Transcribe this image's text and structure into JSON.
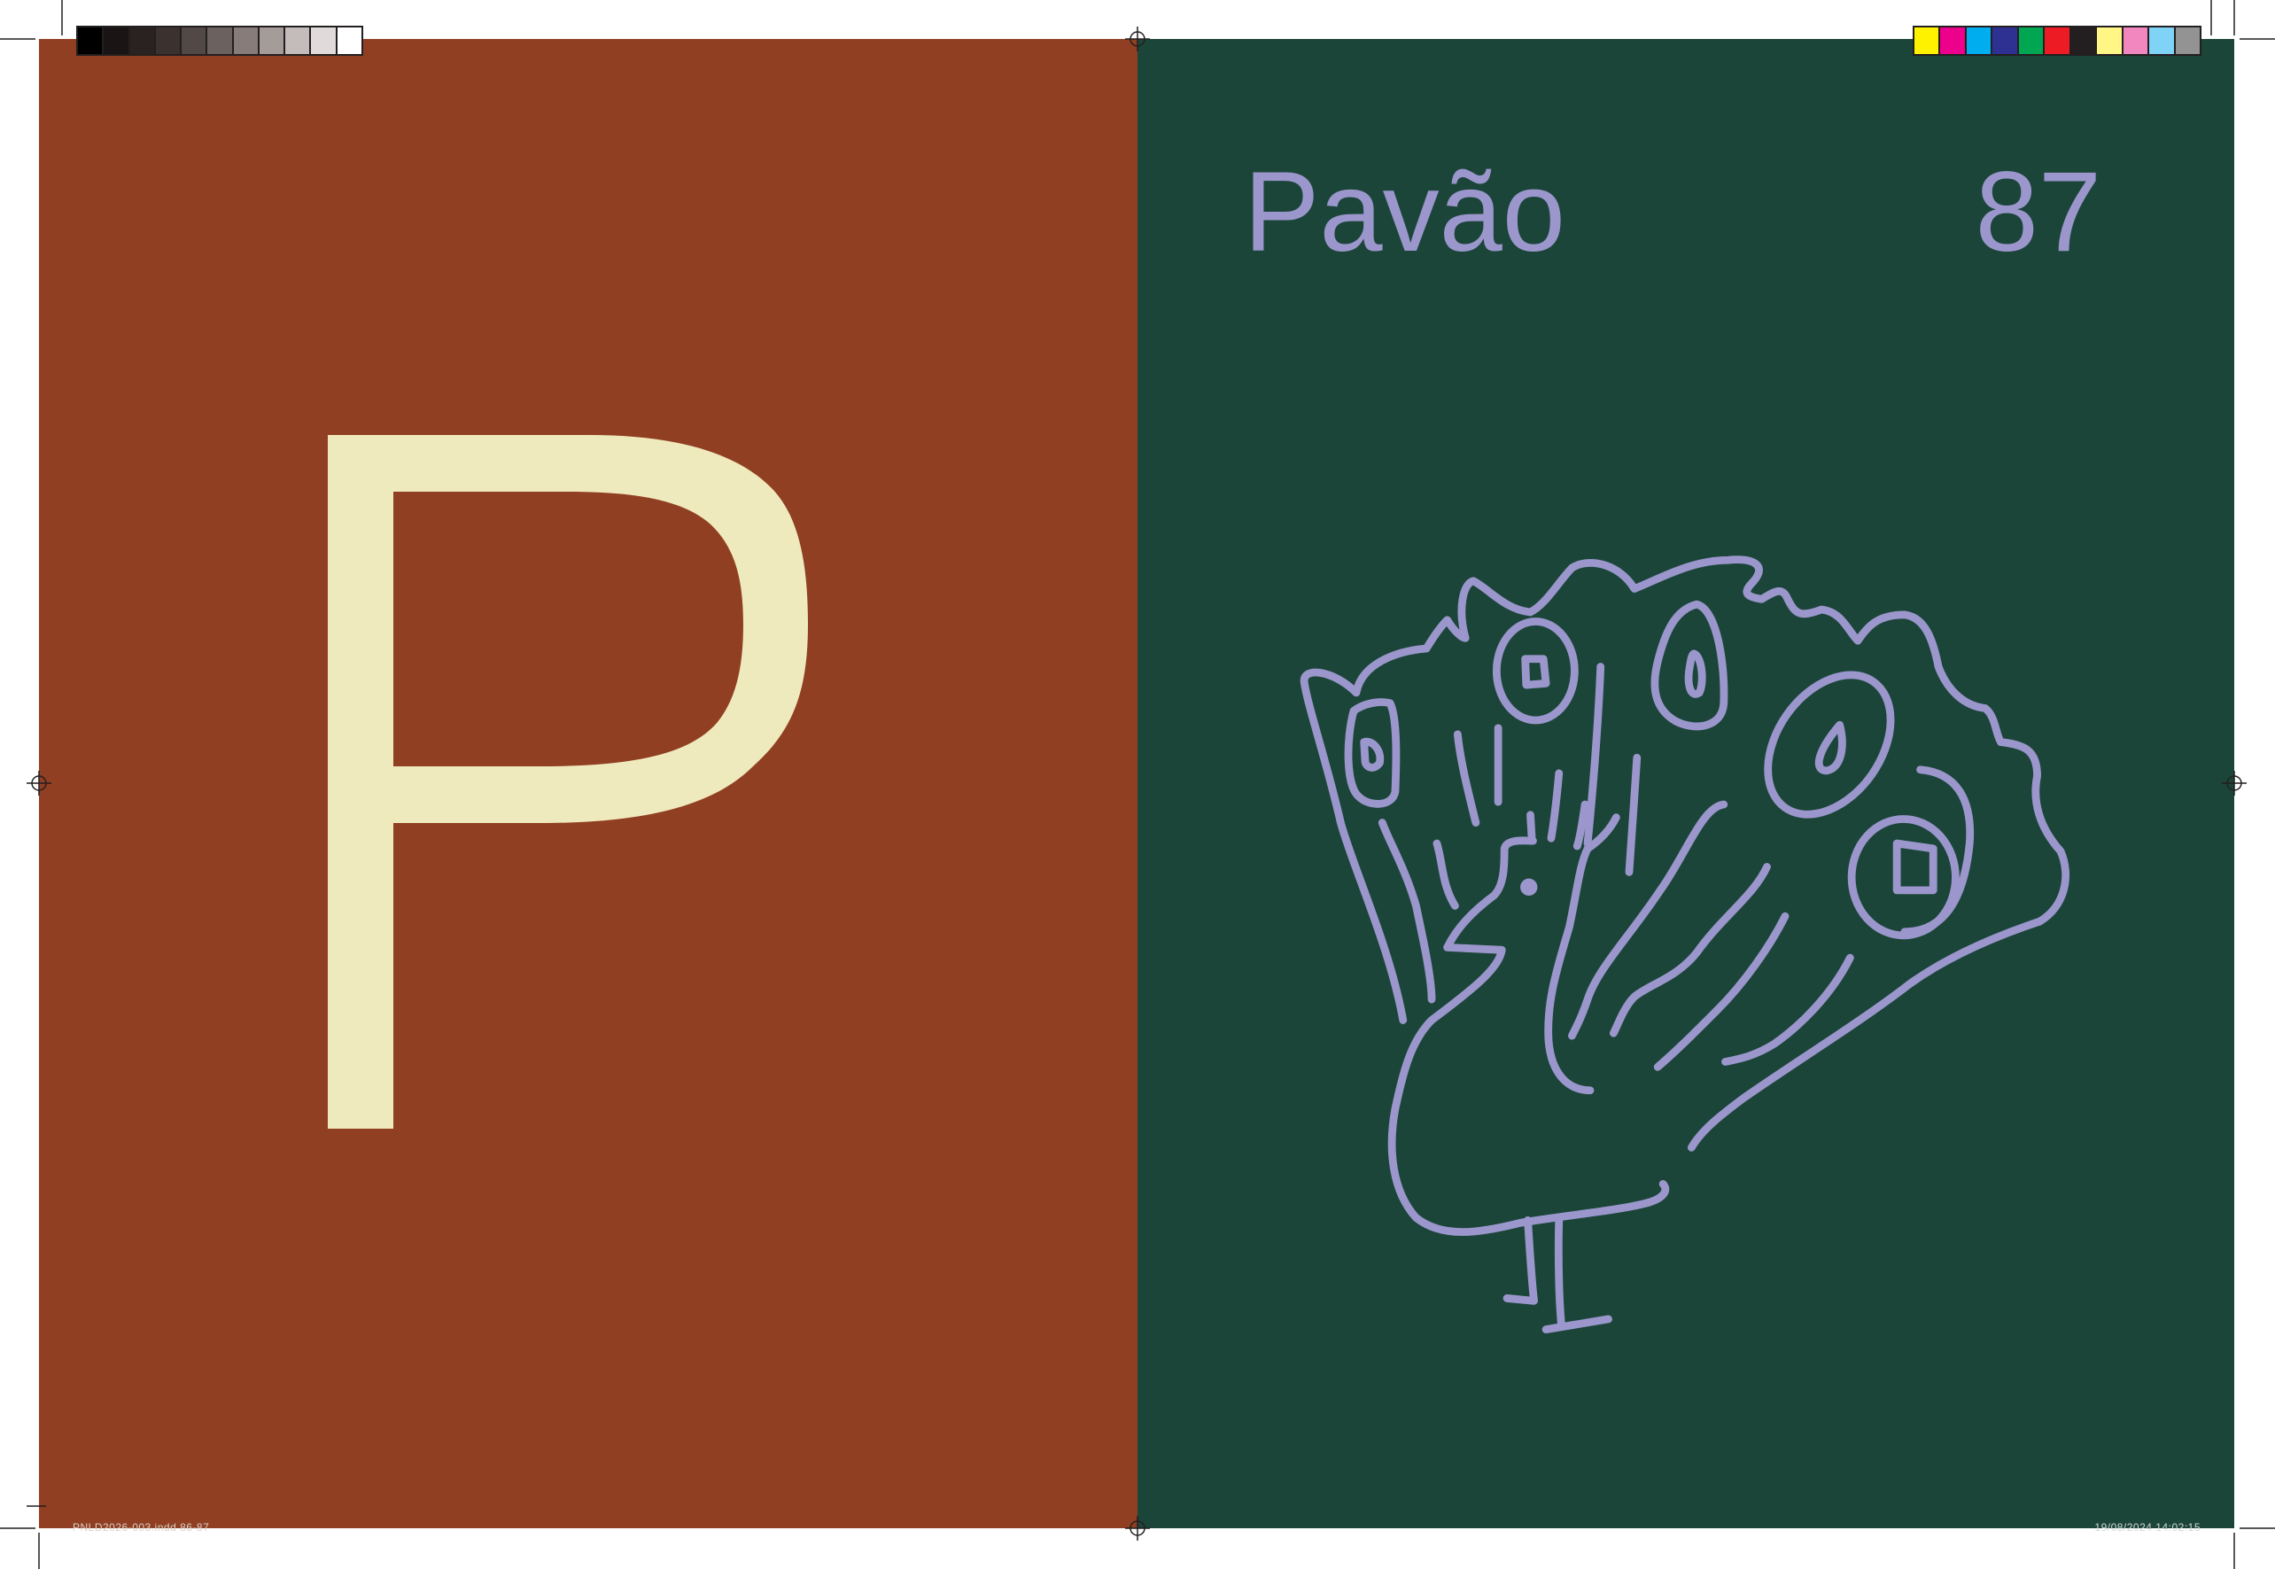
{
  "spread": {
    "left": {
      "letter": "P",
      "background": "#913f22",
      "letter_color": "#efeabd"
    },
    "right": {
      "word": "Pavão",
      "page_number": "87",
      "background": "#1c453a",
      "text_color": "#9b97cc",
      "illustration": "peacock-drawing"
    }
  },
  "print_marks": {
    "slug_file": "PNLD2026-003.indd   86-87",
    "slug_date": "19/08/2024   14:02:15",
    "gray_swatches": [
      "#000000",
      "#1a1414",
      "#2a2220",
      "#3b3230",
      "#524846",
      "#6b615f",
      "#877c7a",
      "#a59b99",
      "#c4bcba",
      "#e0dbda",
      "#ffffff"
    ],
    "color_swatches": [
      "#fff200",
      "#ec008c",
      "#00aeef",
      "#2e3192",
      "#00a651",
      "#ed1c24",
      "#231f20",
      "#fff685",
      "#f287c0",
      "#7fd3f7",
      "#939393"
    ]
  }
}
